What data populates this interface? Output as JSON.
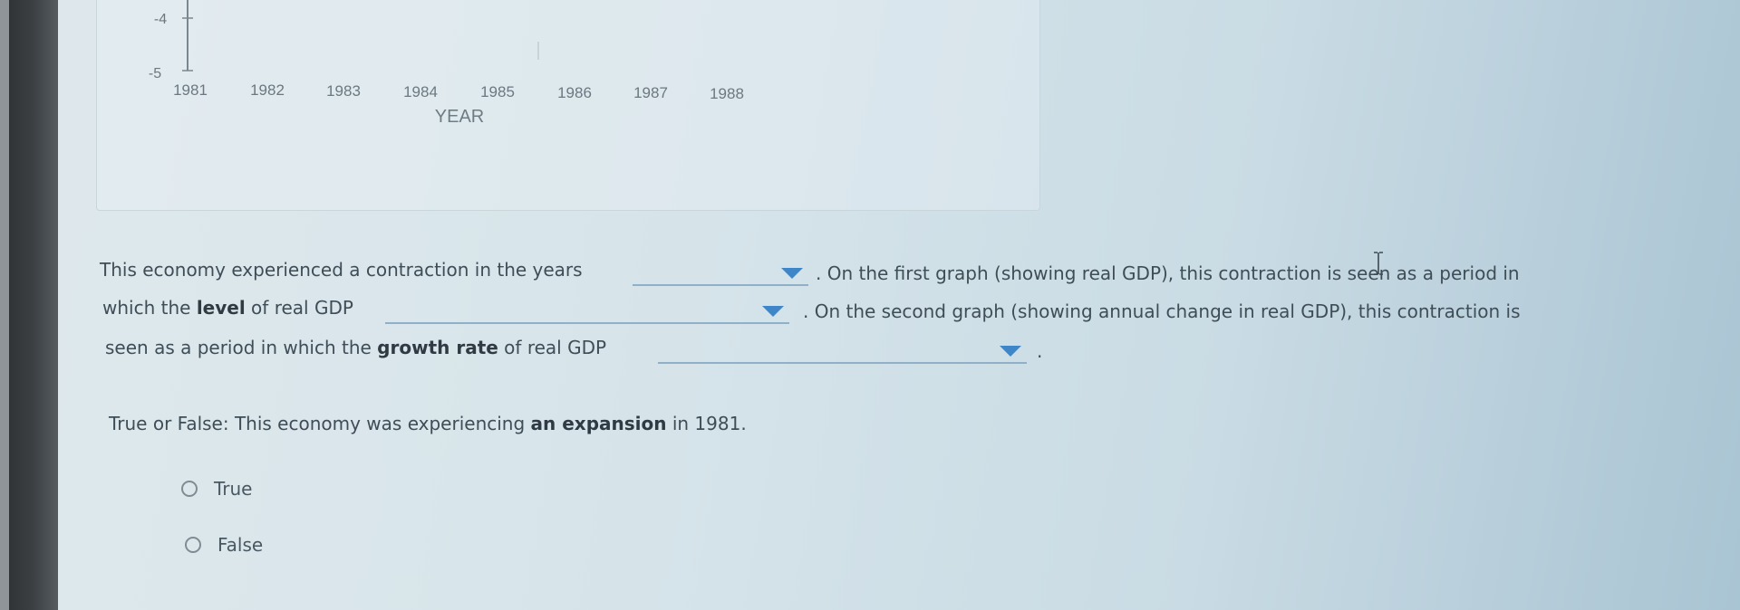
{
  "chart_data": {
    "type": "line",
    "xlabel": "YEAR",
    "x_ticks": [
      "1981",
      "1982",
      "1983",
      "1984",
      "1985",
      "1986",
      "1987",
      "1988"
    ],
    "y_ticks_visible": [
      "-4",
      "-5"
    ]
  },
  "question": {
    "p1_a": "This economy experienced a contraction in the years",
    "p1_b": ". On the first graph (showing real GDP), this contraction is seen as a period in",
    "p2_a": "which the ",
    "p2_bold": "level",
    "p2_b": " of real GDP",
    "p2_c": ". On the second graph (showing annual change in real GDP), this contraction is",
    "p3_a": "seen as a period in which the ",
    "p3_bold": "growth rate",
    "p3_b": " of real GDP",
    "p3_c": ".",
    "dropdown_years": "",
    "dropdown_level": "",
    "dropdown_growth": ""
  },
  "true_false": {
    "prompt_a": "True or False: This economy was experiencing ",
    "prompt_bold": "an expansion",
    "prompt_b": " in 1981.",
    "options": [
      "True",
      "False"
    ]
  },
  "colors": {
    "accent": "#3f86c9",
    "underline": "#8fb0c6",
    "text": "#3f4d57"
  }
}
